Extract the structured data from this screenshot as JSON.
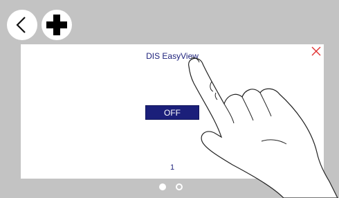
{
  "toolbar": {
    "back_icon": "chevron-left-icon",
    "add_icon": "plus-icon"
  },
  "panel": {
    "title": "DIS EasyView",
    "toggle_label": "OFF",
    "page_number": "1",
    "close_icon": "close-icon"
  },
  "pager": {
    "page_count": 2,
    "current_page": 1
  },
  "colors": {
    "frame": "#c3c3c3",
    "accent": "#1b1f7a",
    "close": "#e03030"
  }
}
